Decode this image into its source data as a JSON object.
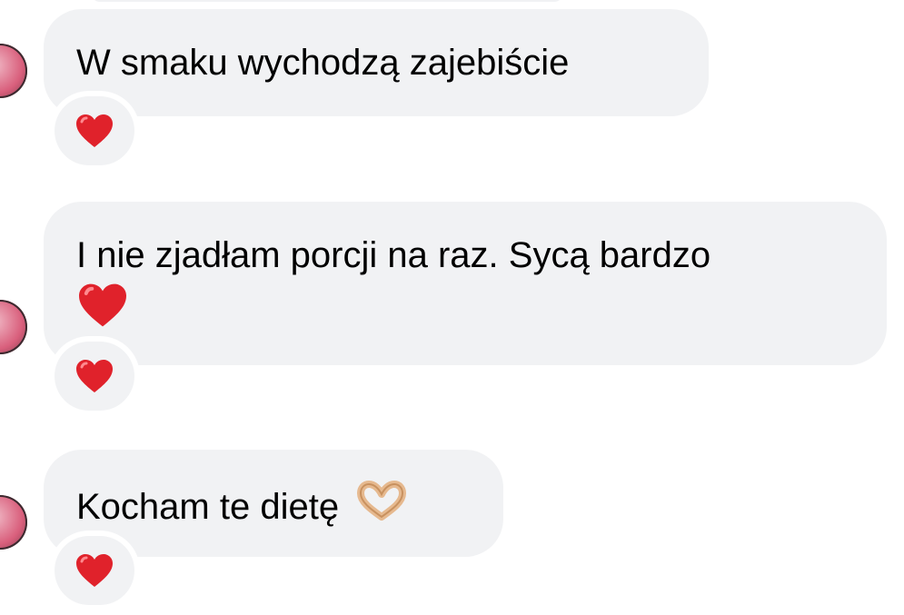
{
  "messages": [
    {
      "text": "W smaku wychodzą zajebiście",
      "reaction": "red-heart"
    },
    {
      "text": "I nie zjadłam porcji na raz. Sycą bardzo",
      "inline_emoji": "red-heart",
      "reaction": "red-heart"
    },
    {
      "text": "Kocham te dietę",
      "inline_emoji": "heart-hands",
      "reaction": "red-heart"
    }
  ],
  "colors": {
    "bubble_bg": "#f1f2f4",
    "heart": "#e0222b",
    "text": "#000000"
  }
}
